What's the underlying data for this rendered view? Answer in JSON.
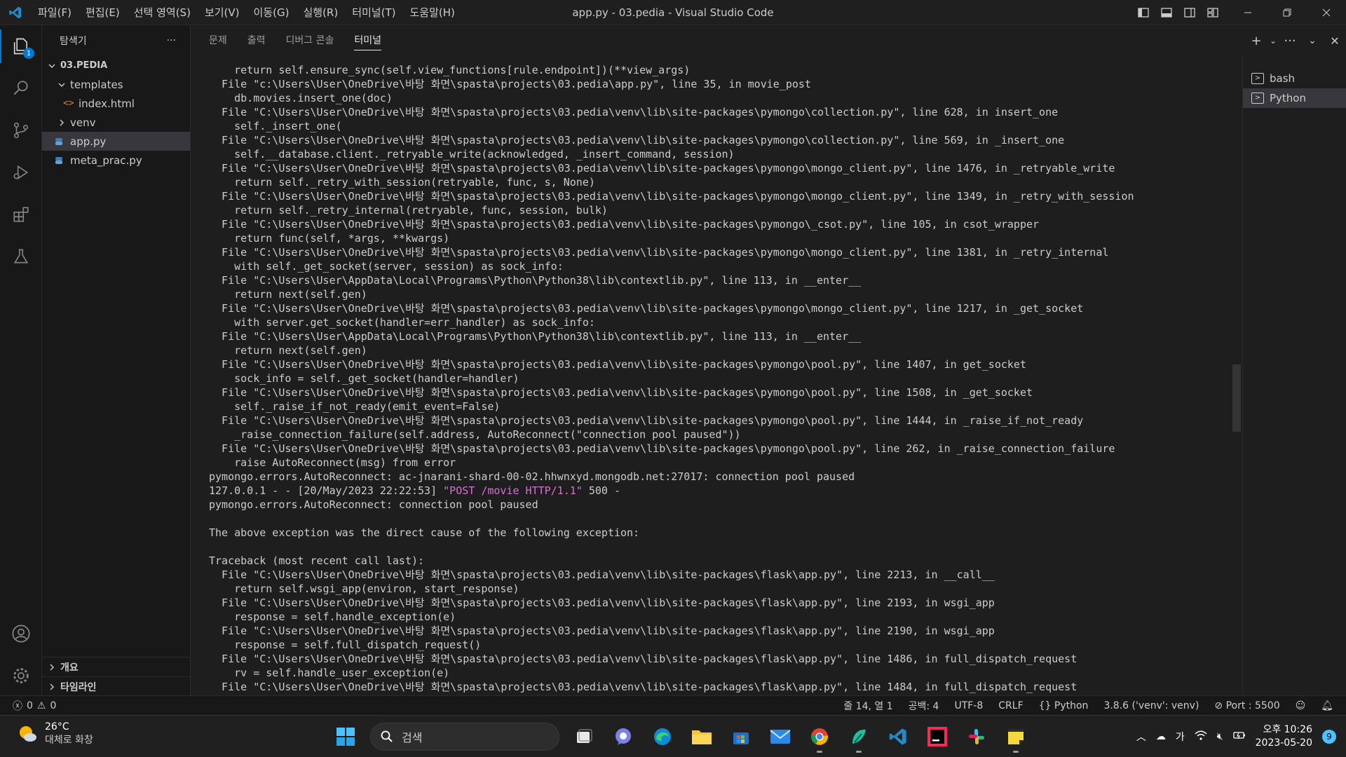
{
  "window": {
    "title": "app.py - 03.pedia - Visual Studio Code",
    "menus": [
      "파일(F)",
      "편집(E)",
      "선택 영역(S)",
      "보기(V)",
      "이동(G)",
      "실행(R)",
      "터미널(T)",
      "도움말(H)"
    ]
  },
  "activity": {
    "explorer_badge": "1"
  },
  "sidebar": {
    "title": "탐색기",
    "more": "···",
    "folder": "03.PEDIA",
    "items": [
      {
        "label": "templates",
        "type": "folder-open"
      },
      {
        "label": "index.html",
        "type": "html-file"
      },
      {
        "label": "venv",
        "type": "folder-closed"
      },
      {
        "label": "app.py",
        "type": "py-file"
      },
      {
        "label": "meta_prac.py",
        "type": "py-file"
      }
    ],
    "outline": "개요",
    "timeline": "타임라인"
  },
  "panel": {
    "tabs": [
      "문제",
      "출력",
      "디버그 콘솔",
      "터미널"
    ],
    "active_tab": "터미널",
    "terminals": [
      "bash",
      "Python"
    ]
  },
  "terminal": {
    "lines": [
      "    return self.ensure_sync(self.view_functions[rule.endpoint])(**view_args)",
      "  File \"c:\\Users\\User\\OneDrive\\바탕 화면\\spasta\\projects\\03.pedia\\app.py\", line 35, in movie_post",
      "    db.movies.insert_one(doc)",
      "  File \"C:\\Users\\User\\OneDrive\\바탕 화면\\spasta\\projects\\03.pedia\\venv\\lib\\site-packages\\pymongo\\collection.py\", line 628, in insert_one",
      "    self._insert_one(",
      "  File \"C:\\Users\\User\\OneDrive\\바탕 화면\\spasta\\projects\\03.pedia\\venv\\lib\\site-packages\\pymongo\\collection.py\", line 569, in _insert_one",
      "    self.__database.client._retryable_write(acknowledged, _insert_command, session)",
      "  File \"C:\\Users\\User\\OneDrive\\바탕 화면\\spasta\\projects\\03.pedia\\venv\\lib\\site-packages\\pymongo\\mongo_client.py\", line 1476, in _retryable_write",
      "    return self._retry_with_session(retryable, func, s, None)",
      "  File \"C:\\Users\\User\\OneDrive\\바탕 화면\\spasta\\projects\\03.pedia\\venv\\lib\\site-packages\\pymongo\\mongo_client.py\", line 1349, in _retry_with_session",
      "    return self._retry_internal(retryable, func, session, bulk)",
      "  File \"C:\\Users\\User\\OneDrive\\바탕 화면\\spasta\\projects\\03.pedia\\venv\\lib\\site-packages\\pymongo\\_csot.py\", line 105, in csot_wrapper",
      "    return func(self, *args, **kwargs)",
      "  File \"C:\\Users\\User\\OneDrive\\바탕 화면\\spasta\\projects\\03.pedia\\venv\\lib\\site-packages\\pymongo\\mongo_client.py\", line 1381, in _retry_internal",
      "    with self._get_socket(server, session) as sock_info:",
      "  File \"C:\\Users\\User\\AppData\\Local\\Programs\\Python\\Python38\\lib\\contextlib.py\", line 113, in __enter__",
      "    return next(self.gen)",
      "  File \"C:\\Users\\User\\OneDrive\\바탕 화면\\spasta\\projects\\03.pedia\\venv\\lib\\site-packages\\pymongo\\mongo_client.py\", line 1217, in _get_socket",
      "    with server.get_socket(handler=err_handler) as sock_info:",
      "  File \"C:\\Users\\User\\AppData\\Local\\Programs\\Python\\Python38\\lib\\contextlib.py\", line 113, in __enter__",
      "    return next(self.gen)",
      "  File \"C:\\Users\\User\\OneDrive\\바탕 화면\\spasta\\projects\\03.pedia\\venv\\lib\\site-packages\\pymongo\\pool.py\", line 1407, in get_socket",
      "    sock_info = self._get_socket(handler=handler)",
      "  File \"C:\\Users\\User\\OneDrive\\바탕 화면\\spasta\\projects\\03.pedia\\venv\\lib\\site-packages\\pymongo\\pool.py\", line 1508, in _get_socket",
      "    self._raise_if_not_ready(emit_event=False)",
      "  File \"C:\\Users\\User\\OneDrive\\바탕 화면\\spasta\\projects\\03.pedia\\venv\\lib\\site-packages\\pymongo\\pool.py\", line 1444, in _raise_if_not_ready",
      "    _raise_connection_failure(self.address, AutoReconnect(\"connection pool paused\"))",
      "  File \"C:\\Users\\User\\OneDrive\\바탕 화면\\spasta\\projects\\03.pedia\\venv\\lib\\site-packages\\pymongo\\pool.py\", line 262, in _raise_connection_failure",
      "    raise AutoReconnect(msg) from error",
      "pymongo.errors.AutoReconnect: ac-jnarani-shard-00-02.hhwnxyd.mongodb.net:27017: connection pool paused"
    ],
    "log_prefix": "127.0.0.1 - - [20/May/2023 22:22:53] ",
    "log_request": "\"POST /movie HTTP/1.1\"",
    "log_suffix": " 500 -",
    "lines2": [
      "pymongo.errors.AutoReconnect: connection pool paused",
      "",
      "The above exception was the direct cause of the following exception:",
      "",
      "Traceback (most recent call last):",
      "  File \"C:\\Users\\User\\OneDrive\\바탕 화면\\spasta\\projects\\03.pedia\\venv\\lib\\site-packages\\flask\\app.py\", line 2213, in __call__",
      "    return self.wsgi_app(environ, start_response)",
      "  File \"C:\\Users\\User\\OneDrive\\바탕 화면\\spasta\\projects\\03.pedia\\venv\\lib\\site-packages\\flask\\app.py\", line 2193, in wsgi_app",
      "    response = self.handle_exception(e)",
      "  File \"C:\\Users\\User\\OneDrive\\바탕 화면\\spasta\\projects\\03.pedia\\venv\\lib\\site-packages\\flask\\app.py\", line 2190, in wsgi_app",
      "    response = self.full_dispatch_request()",
      "  File \"C:\\Users\\User\\OneDrive\\바탕 화면\\spasta\\projects\\03.pedia\\venv\\lib\\site-packages\\flask\\app.py\", line 1486, in full_dispatch_request",
      "    rv = self.handle_user_exception(e)",
      "  File \"C:\\Users\\User\\OneDrive\\바탕 화면\\spasta\\projects\\03.pedia\\venv\\lib\\site-packages\\flask\\app.py\", line 1484, in full_dispatch_request"
    ]
  },
  "status": {
    "errors": "0",
    "warnings": "0",
    "position": "줄 14, 열 1",
    "spaces": "공백: 4",
    "encoding": "UTF-8",
    "eol": "CRLF",
    "language": "Python",
    "interpreter": "3.8.6 ('venv': venv)",
    "port": "Port : 5500"
  },
  "taskbar": {
    "temp": "26°C",
    "weather": "대체로 화창",
    "search_placeholder": "검색",
    "tray_lang": "가",
    "time": "오후 10:26",
    "date": "2023-05-20",
    "notifications": "9"
  },
  "colors": {
    "accent": "#0078d4",
    "highlight": "#d670d6",
    "taskbar_focus": "#4cc2ff"
  }
}
